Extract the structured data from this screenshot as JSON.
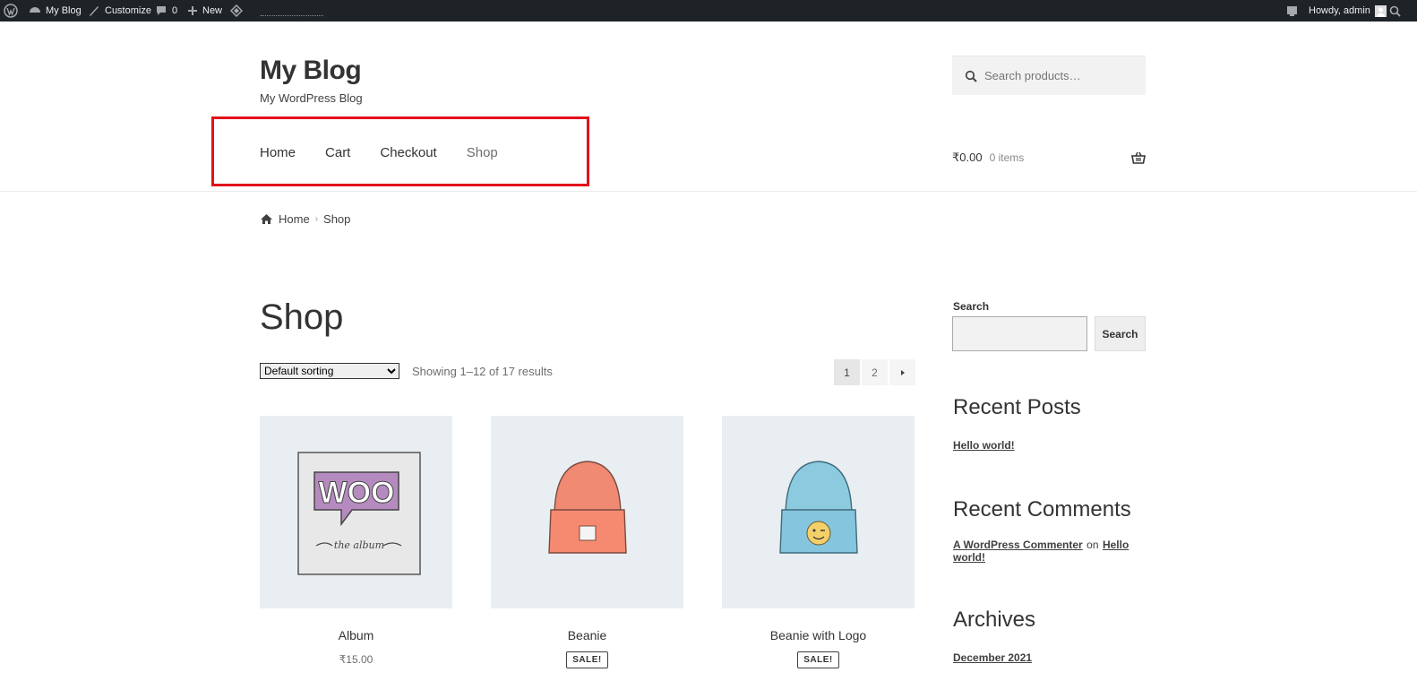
{
  "adminbar": {
    "site": "My Blog",
    "customize": "Customize",
    "comments_count": "0",
    "new": "New",
    "howdy": "Howdy, admin"
  },
  "header": {
    "site_title": "My Blog",
    "site_description": "My WordPress Blog",
    "search_placeholder": "Search products…",
    "nav": [
      "Home",
      "Cart",
      "Checkout",
      "Shop"
    ],
    "cart_amount": "₹0.00",
    "cart_items": "0 items"
  },
  "breadcrumb": {
    "home": "Home",
    "current": "Shop"
  },
  "main": {
    "title": "Shop",
    "sorting_selected": "Default sorting",
    "result_count": "Showing 1–12 of 17 results",
    "pages": [
      "1",
      "2"
    ],
    "products": [
      {
        "name": "Album",
        "price": "₹15.00",
        "badge": ""
      },
      {
        "name": "Beanie",
        "price": "",
        "badge": "SALE!"
      },
      {
        "name": "Beanie with Logo",
        "price": "",
        "badge": "SALE!"
      }
    ]
  },
  "sidebar": {
    "search_label": "Search",
    "search_button": "Search",
    "recent_posts_heading": "Recent Posts",
    "recent_post_1": "Hello world!",
    "recent_comments_heading": "Recent Comments",
    "comment_author": "A WordPress Commenter",
    "comment_on": "on",
    "comment_post": "Hello world!",
    "archives_heading": "Archives",
    "archive_1": "December 2021"
  },
  "colors": {
    "adminbar_bg": "#1d2327",
    "highlight_border": "#e3101b",
    "product_bg": "#e9eef2"
  }
}
